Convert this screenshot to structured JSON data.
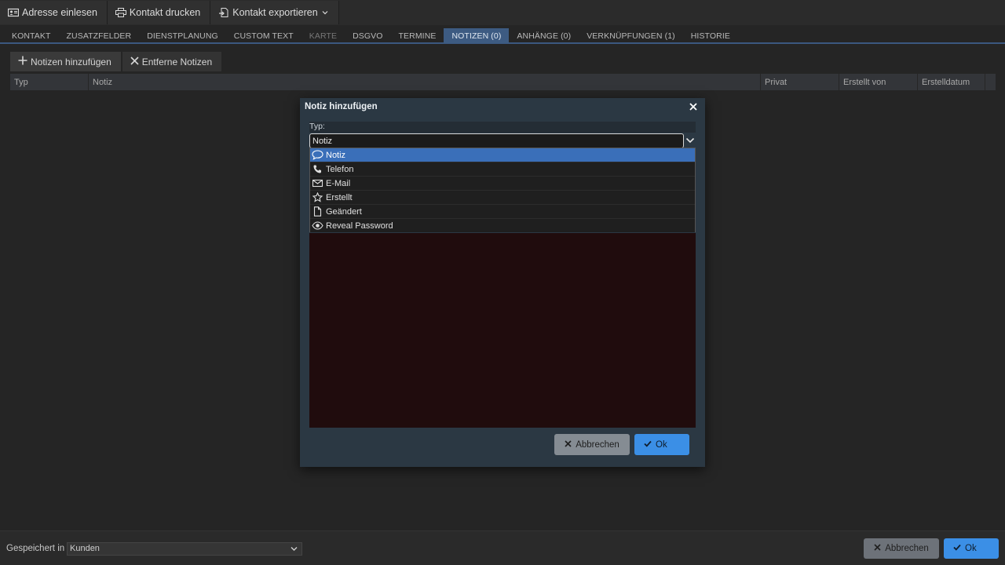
{
  "toolbar": {
    "read_address": "Adresse einlesen",
    "print_contact": "Kontakt drucken",
    "export_contact": "Kontakt exportieren"
  },
  "tabs": [
    {
      "label": "KONTAKT",
      "state": "normal"
    },
    {
      "label": "ZUSATZFELDER",
      "state": "normal"
    },
    {
      "label": "DIENSTPLANUNG",
      "state": "normal"
    },
    {
      "label": "CUSTOM TEXT",
      "state": "normal"
    },
    {
      "label": "KARTE",
      "state": "disabled"
    },
    {
      "label": "DSGVO",
      "state": "normal"
    },
    {
      "label": "TERMINE",
      "state": "normal"
    },
    {
      "label": "NOTIZEN (0)",
      "state": "active"
    },
    {
      "label": "ANHÄNGE (0)",
      "state": "normal"
    },
    {
      "label": "VERKNÜPFUNGEN (1)",
      "state": "normal"
    },
    {
      "label": "HISTORIE",
      "state": "normal"
    }
  ],
  "notes_toolbar": {
    "add_label": "Notizen hinzufügen",
    "remove_label": "Entferne Notizen"
  },
  "table": {
    "columns": [
      "Typ",
      "Notiz",
      "Privat",
      "Erstellt von",
      "Erstelldatum"
    ]
  },
  "dialog": {
    "title": "Notiz hinzufügen",
    "type_label": "Typ:",
    "type_value": "Notiz",
    "options": [
      {
        "label": "Notiz",
        "icon": "speech-bubble-icon",
        "selected": true
      },
      {
        "label": "Telefon",
        "icon": "phone-icon",
        "selected": false
      },
      {
        "label": "E-Mail",
        "icon": "envelope-icon",
        "selected": false
      },
      {
        "label": "Erstellt",
        "icon": "star-icon",
        "selected": false
      },
      {
        "label": "Geändert",
        "icon": "document-icon",
        "selected": false
      },
      {
        "label": "Reveal Password",
        "icon": "eye-icon",
        "selected": false
      }
    ],
    "cancel_label": "Abbrechen",
    "ok_label": "Ok"
  },
  "footer": {
    "saved_in_label": "Gespeichert in",
    "saved_in_value": "Kunden",
    "cancel_label": "Abbrechen",
    "ok_label": "Ok"
  },
  "colors": {
    "accent": "#3b8fe6",
    "active_tab": "#3d5b82",
    "selected_option": "#3a6fb9",
    "dialog_bg": "#2b3843",
    "textarea_bg": "#200c0d"
  }
}
